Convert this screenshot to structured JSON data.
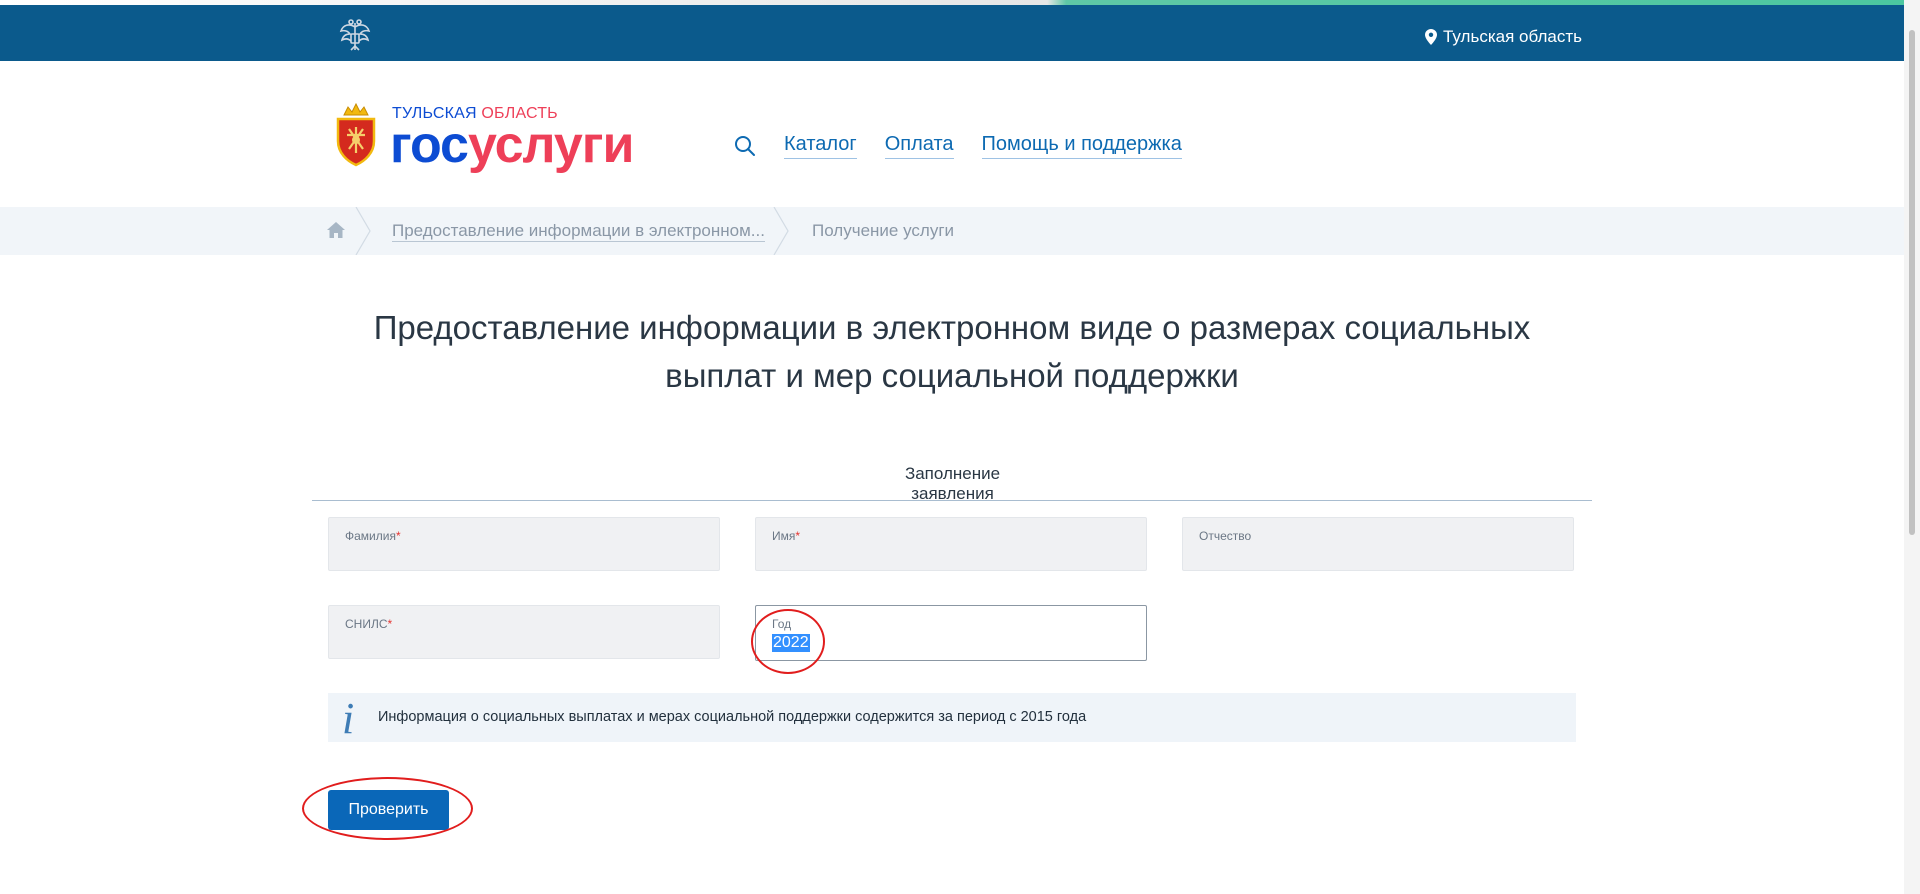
{
  "topbar": {
    "region": "Тульская область"
  },
  "header": {
    "logo_region_part1": "ТУЛЬСКАЯ ",
    "logo_region_part2": "ОБЛАСТЬ",
    "logo_main_part1": "гос",
    "logo_main_part2": "услуги",
    "nav": {
      "catalog": "Каталог",
      "payment": "Оплата",
      "help": "Помощь и поддержка"
    }
  },
  "breadcrumbs": {
    "item1": "Предоставление информации в электронном...",
    "item2": "Получение услуги"
  },
  "page": {
    "title_line1": "Предоставление информации в электронном виде о размерах социальных",
    "title_line2": "выплат и мер социальной поддержки",
    "tab_label": "Заполнение заявления"
  },
  "form": {
    "lastname_label": "Фамилия",
    "firstname_label": "Имя",
    "patronymic_label": "Отчество",
    "snils_label": "СНИЛС",
    "year_label": "Год",
    "year_value": "2022",
    "required_mark": "*"
  },
  "info": {
    "icon_glyph": "i",
    "text": "Информация о социальных выплатах и мерах социальной поддержки содержится за период с 2015 года"
  },
  "actions": {
    "check_label": "Проверить"
  },
  "colors": {
    "topbar": "#0b5a8c",
    "brand_blue": "#0d4cd3",
    "brand_red": "#ee3f58",
    "button": "#0a67b8",
    "annotation": "#e11d1d"
  },
  "icons": [
    "emblem-icon",
    "location-pin-icon",
    "coat-of-arms-icon",
    "search-icon",
    "home-icon",
    "info-icon"
  ]
}
